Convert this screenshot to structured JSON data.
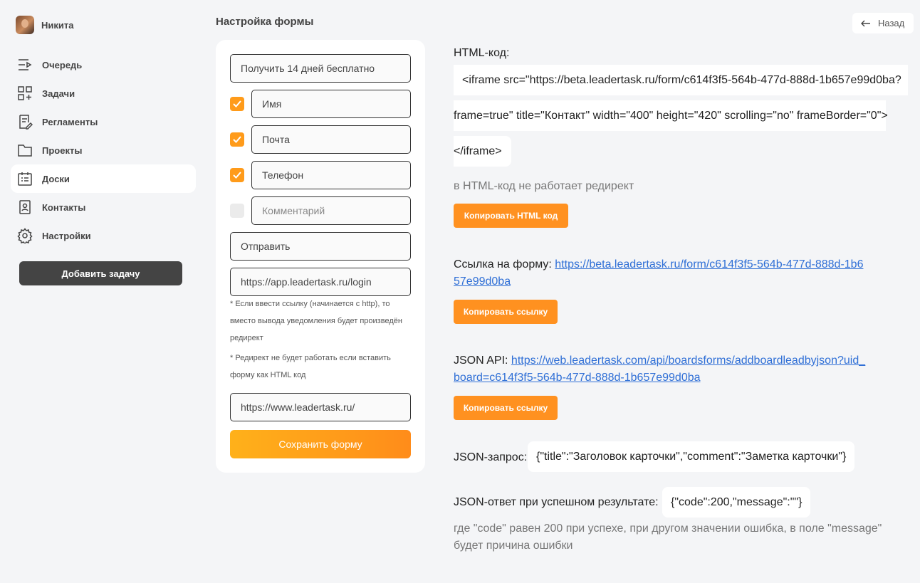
{
  "user": {
    "name": "Никита"
  },
  "nav": [
    {
      "label": "Очередь",
      "icon": "queue-icon"
    },
    {
      "label": "Задачи",
      "icon": "tasks-icon"
    },
    {
      "label": "Регламенты",
      "icon": "regulations-icon"
    },
    {
      "label": "Проекты",
      "icon": "folder-icon"
    },
    {
      "label": "Доски",
      "icon": "board-icon",
      "active": true
    },
    {
      "label": "Контакты",
      "icon": "contacts-icon"
    },
    {
      "label": "Настройки",
      "icon": "gear-icon"
    }
  ],
  "add_task_label": "Добавить задачу",
  "page_title": "Настройка формы",
  "back_label": "Назад",
  "form": {
    "title_value": "Получить 14 дней бесплатно",
    "fields": [
      {
        "label": "Имя",
        "checked": true
      },
      {
        "label": "Почта",
        "checked": true
      },
      {
        "label": "Телефон",
        "checked": true
      },
      {
        "label": "Комментарий",
        "checked": false
      }
    ],
    "submit_value": "Отправить",
    "redirect_value": "https://app.leadertask.ru/login",
    "note1": "* Если ввести ссылку (начинается с http), то вместо вывода уведомления будет произведён редирект",
    "note2": "* Редирект не будет работать если вставить форму как HTML код",
    "site_value": "https://www.leadertask.ru/",
    "save_label": "Сохранить форму"
  },
  "html_code": {
    "label": "HTML-код:",
    "line1": "<iframe src=\"https://beta.leadertask.ru/form/c614f3f5-564b-477d-888d-1b657e99d0ba?",
    "line2": "frame=true\" title=\"Контакт\" width=\"400\" height=\"420\" scrolling=\"no\" frameBorder=\"0\">",
    "line3": "</iframe>",
    "note": "в HTML-код не работает редирект",
    "copy_label": "Копировать HTML код"
  },
  "form_link": {
    "label": "Ссылка на форму: ",
    "url": "https://beta.leadertask.ru/form/c614f3f5-564b-477d-888d-1b657e99d0ba",
    "copy_label": "Копировать ссылку"
  },
  "json_api": {
    "label": "JSON API: ",
    "url": "https://web.leadertask.com/api/boardsforms/addboardleadbyjson?uid_board=c614f3f5-564b-477d-888d-1b657e99d0ba",
    "copy_label": "Копировать ссылку"
  },
  "json_request": {
    "label": "JSON-запрос:",
    "value": "{\"title\":\"Заголовок карточки\",\"comment\":\"Заметка карточки\"}"
  },
  "json_response": {
    "label": "JSON-ответ при успешном результате:",
    "value": "{\"code\":200,\"message\":\"\"}",
    "note": "где \"code\" равен 200 при успехе, при другом значении ошибка, в поле \"message\" будет причина ошибки"
  },
  "colors": {
    "accent": "#ff9120",
    "link": "#2f6fd6",
    "dark_button": "#444444"
  }
}
